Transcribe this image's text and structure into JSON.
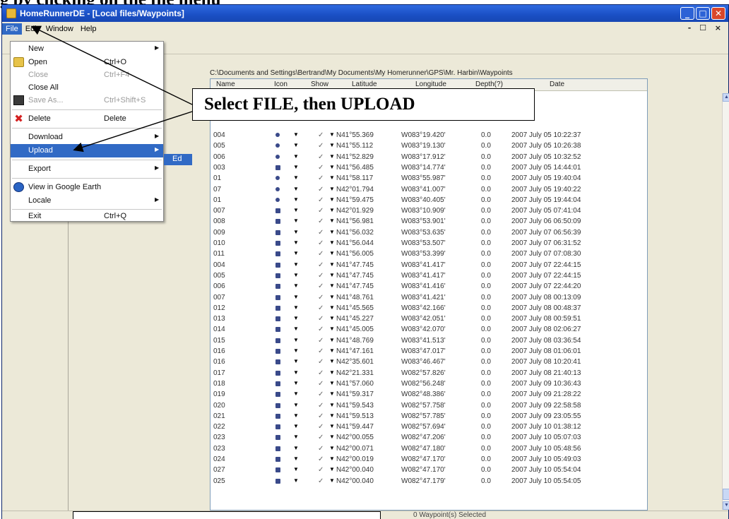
{
  "heading": "g by clicking on the file menu",
  "window": {
    "title": "HomeRunnerDE - [Local files/Waypoints]",
    "buttons": {
      "minimize": "_",
      "maximize": "□",
      "close": "✕"
    }
  },
  "menubar": {
    "items": [
      "File",
      "Edit",
      "Window",
      "Help"
    ],
    "mdi_controls": "- ☐ ×"
  },
  "path": "C:\\Documents and Settings\\Bertrand\\My Documents\\My Homerunner\\GPS\\Mr. Harbin\\Waypoints",
  "table": {
    "columns": [
      "Name",
      "Icon",
      "Show",
      "Latitude",
      "Longitude",
      "Depth(?)",
      "Date"
    ],
    "rows": [
      {
        "name": "004",
        "icon": "dot",
        "lat": "N41°55.369",
        "lon": "W083°19.420'",
        "depth": "0.0",
        "date": "2007 July 05 10:22:37"
      },
      {
        "name": "005",
        "icon": "dot",
        "lat": "N41°55.112",
        "lon": "W083°19.130'",
        "depth": "0.0",
        "date": "2007 July 05 10:26:38"
      },
      {
        "name": "006",
        "icon": "dot",
        "lat": "N41°52.829",
        "lon": "W083°17.912'",
        "depth": "0.0",
        "date": "2007 July 05 10:32:52"
      },
      {
        "name": "003",
        "icon": "wp",
        "lat": "N41°56.485",
        "lon": "W083°14.774'",
        "depth": "0.0",
        "date": "2007 July 05 14:44:01"
      },
      {
        "name": "01",
        "icon": "dot",
        "lat": "N41°58.117",
        "lon": "W083°55.987'",
        "depth": "0.0",
        "date": "2007 July 05 19:40:04"
      },
      {
        "name": "07",
        "icon": "dot",
        "lat": "N42°01.794",
        "lon": "W083°41.007'",
        "depth": "0.0",
        "date": "2007 July 05 19:40:22"
      },
      {
        "name": "01",
        "icon": "dot",
        "lat": "N41°59.475",
        "lon": "W083°40.405'",
        "depth": "0.0",
        "date": "2007 July 05 19:44:04"
      },
      {
        "name": "007",
        "icon": "wp",
        "lat": "N42°01.929",
        "lon": "W083°10.909'",
        "depth": "0.0",
        "date": "2007 July 05 07:41:04"
      },
      {
        "name": "008",
        "icon": "wp",
        "lat": "N41°56.981",
        "lon": "W083°53.901'",
        "depth": "0.0",
        "date": "2007 July 06 06:50:09"
      },
      {
        "name": "009",
        "icon": "wp",
        "lat": "N41°56.032",
        "lon": "W083°53.635'",
        "depth": "0.0",
        "date": "2007 July 07 06:56:39"
      },
      {
        "name": "010",
        "icon": "wp",
        "lat": "N41°56.044",
        "lon": "W083°53.507'",
        "depth": "0.0",
        "date": "2007 July 07 06:31:52"
      },
      {
        "name": "011",
        "icon": "wp",
        "lat": "N41°56.005",
        "lon": "W083°53.399'",
        "depth": "0.0",
        "date": "2007 July 07 07:08:30"
      },
      {
        "name": "004",
        "icon": "wp",
        "lat": "N41°47.745",
        "lon": "W083°41.417'",
        "depth": "0.0",
        "date": "2007 July 07 22:44:15"
      },
      {
        "name": "005",
        "icon": "wp",
        "lat": "N41°47.745",
        "lon": "W083°41.417'",
        "depth": "0.0",
        "date": "2007 July 07 22:44:15"
      },
      {
        "name": "006",
        "icon": "wp",
        "lat": "N41°47.745",
        "lon": "W083°41.416'",
        "depth": "0.0",
        "date": "2007 July 07 22:44:20"
      },
      {
        "name": "007",
        "icon": "wp",
        "lat": "N41°48.761",
        "lon": "W083°41.421'",
        "depth": "0.0",
        "date": "2007 July 08 00:13:09"
      },
      {
        "name": "012",
        "icon": "wp",
        "lat": "N41°45.565",
        "lon": "W083°42.166'",
        "depth": "0.0",
        "date": "2007 July 08 00:48:37"
      },
      {
        "name": "013",
        "icon": "wp",
        "lat": "N41°45.227",
        "lon": "W083°42.051'",
        "depth": "0.0",
        "date": "2007 July 08 00:59:51"
      },
      {
        "name": "014",
        "icon": "wp",
        "lat": "N41°45.005",
        "lon": "W083°42.070'",
        "depth": "0.0",
        "date": "2007 July 08 02:06:27"
      },
      {
        "name": "015",
        "icon": "wp",
        "lat": "N41°48.769",
        "lon": "W083°41.513'",
        "depth": "0.0",
        "date": "2007 July 08 03:36:54"
      },
      {
        "name": "016",
        "icon": "wp",
        "lat": "N41°47.161",
        "lon": "W083°47.017'",
        "depth": "0.0",
        "date": "2007 July 08 01:06:01"
      },
      {
        "name": "016",
        "icon": "wp",
        "lat": "N42°35.601",
        "lon": "W083°46.467'",
        "depth": "0.0",
        "date": "2007 July 08 10:20:41"
      },
      {
        "name": "017",
        "icon": "wp",
        "lat": "N42°21.331",
        "lon": "W082°57.826'",
        "depth": "0.0",
        "date": "2007 July 08 21:40:13"
      },
      {
        "name": "018",
        "icon": "wp",
        "lat": "N41°57.060",
        "lon": "W082°56.248'",
        "depth": "0.0",
        "date": "2007 July 09 10:36:43"
      },
      {
        "name": "019",
        "icon": "wp",
        "lat": "N41°59.317",
        "lon": "W082°48.386'",
        "depth": "0.0",
        "date": "2007 July 09 21:28:22"
      },
      {
        "name": "020",
        "icon": "wp",
        "lat": "N41°59.543",
        "lon": "W082°57.758'",
        "depth": "0.0",
        "date": "2007 July 09 22:58:58"
      },
      {
        "name": "021",
        "icon": "wp",
        "lat": "N41°59.513",
        "lon": "W082°57.785'",
        "depth": "0.0",
        "date": "2007 July 09 23:05:55"
      },
      {
        "name": "022",
        "icon": "wp",
        "lat": "N41°59.447",
        "lon": "W082°57.694'",
        "depth": "0.0",
        "date": "2007 July 10 01:38:12"
      },
      {
        "name": "023",
        "icon": "wp",
        "lat": "N42°00.055",
        "lon": "W082°47.206'",
        "depth": "0.0",
        "date": "2007 July 10 05:07:03"
      },
      {
        "name": "023",
        "icon": "wp",
        "lat": "N42°00.071",
        "lon": "W082°47.180'",
        "depth": "0.0",
        "date": "2007 July 10 05:48:56"
      },
      {
        "name": "024",
        "icon": "wp",
        "lat": "N42°00.019",
        "lon": "W082°47.170'",
        "depth": "0.0",
        "date": "2007 July 10 05:49:03"
      },
      {
        "name": "027",
        "icon": "wp",
        "lat": "N42°00.040",
        "lon": "W082°47.170'",
        "depth": "0.0",
        "date": "2007 July 10 05:54:04"
      },
      {
        "name": "025",
        "icon": "wp",
        "lat": "N42°00.040",
        "lon": "W082°47.179'",
        "depth": "0.0",
        "date": "2007 July 10 05:54:05"
      }
    ]
  },
  "file_menu": {
    "items": [
      {
        "label": "New",
        "shortcut": "",
        "submenu": true,
        "disabled": false,
        "icon": ""
      },
      {
        "label": "Open",
        "shortcut": "Ctrl+O",
        "submenu": false,
        "disabled": false,
        "icon": "folder-icon"
      },
      {
        "label": "Close",
        "shortcut": "Ctrl+F4",
        "submenu": false,
        "disabled": true,
        "icon": ""
      },
      {
        "label": "Close All",
        "shortcut": "",
        "submenu": false,
        "disabled": false,
        "icon": ""
      },
      {
        "label": "Save As...",
        "shortcut": "Ctrl+Shift+S",
        "submenu": false,
        "disabled": true,
        "icon": "save-icon"
      },
      {
        "label": "Delete",
        "shortcut": "Delete",
        "submenu": false,
        "disabled": false,
        "icon": "delete-icon"
      },
      {
        "label": "Download",
        "shortcut": "",
        "submenu": true,
        "disabled": false,
        "icon": ""
      },
      {
        "label": "Upload",
        "shortcut": "",
        "submenu": true,
        "disabled": false,
        "icon": "",
        "highlight": true
      },
      {
        "label": "Export",
        "shortcut": "",
        "submenu": true,
        "disabled": false,
        "icon": ""
      },
      {
        "label": "View in Google Earth",
        "shortcut": "",
        "submenu": false,
        "disabled": false,
        "icon": "google-earth-icon"
      },
      {
        "label": "Locale",
        "shortcut": "",
        "submenu": true,
        "disabled": false,
        "icon": ""
      },
      {
        "label": "Exit",
        "shortcut": "Ctrl+Q",
        "submenu": false,
        "disabled": false,
        "icon": ""
      }
    ],
    "upload_submenu_item": "Ed"
  },
  "callout": {
    "text": "Select FILE, then UPLOAD"
  },
  "status": {
    "text": "0 Waypoint(s) Selected"
  },
  "colors": {
    "titlebar": "#1a4fc4",
    "highlight": "#316ac5",
    "window_bg": "#ece9d8"
  }
}
